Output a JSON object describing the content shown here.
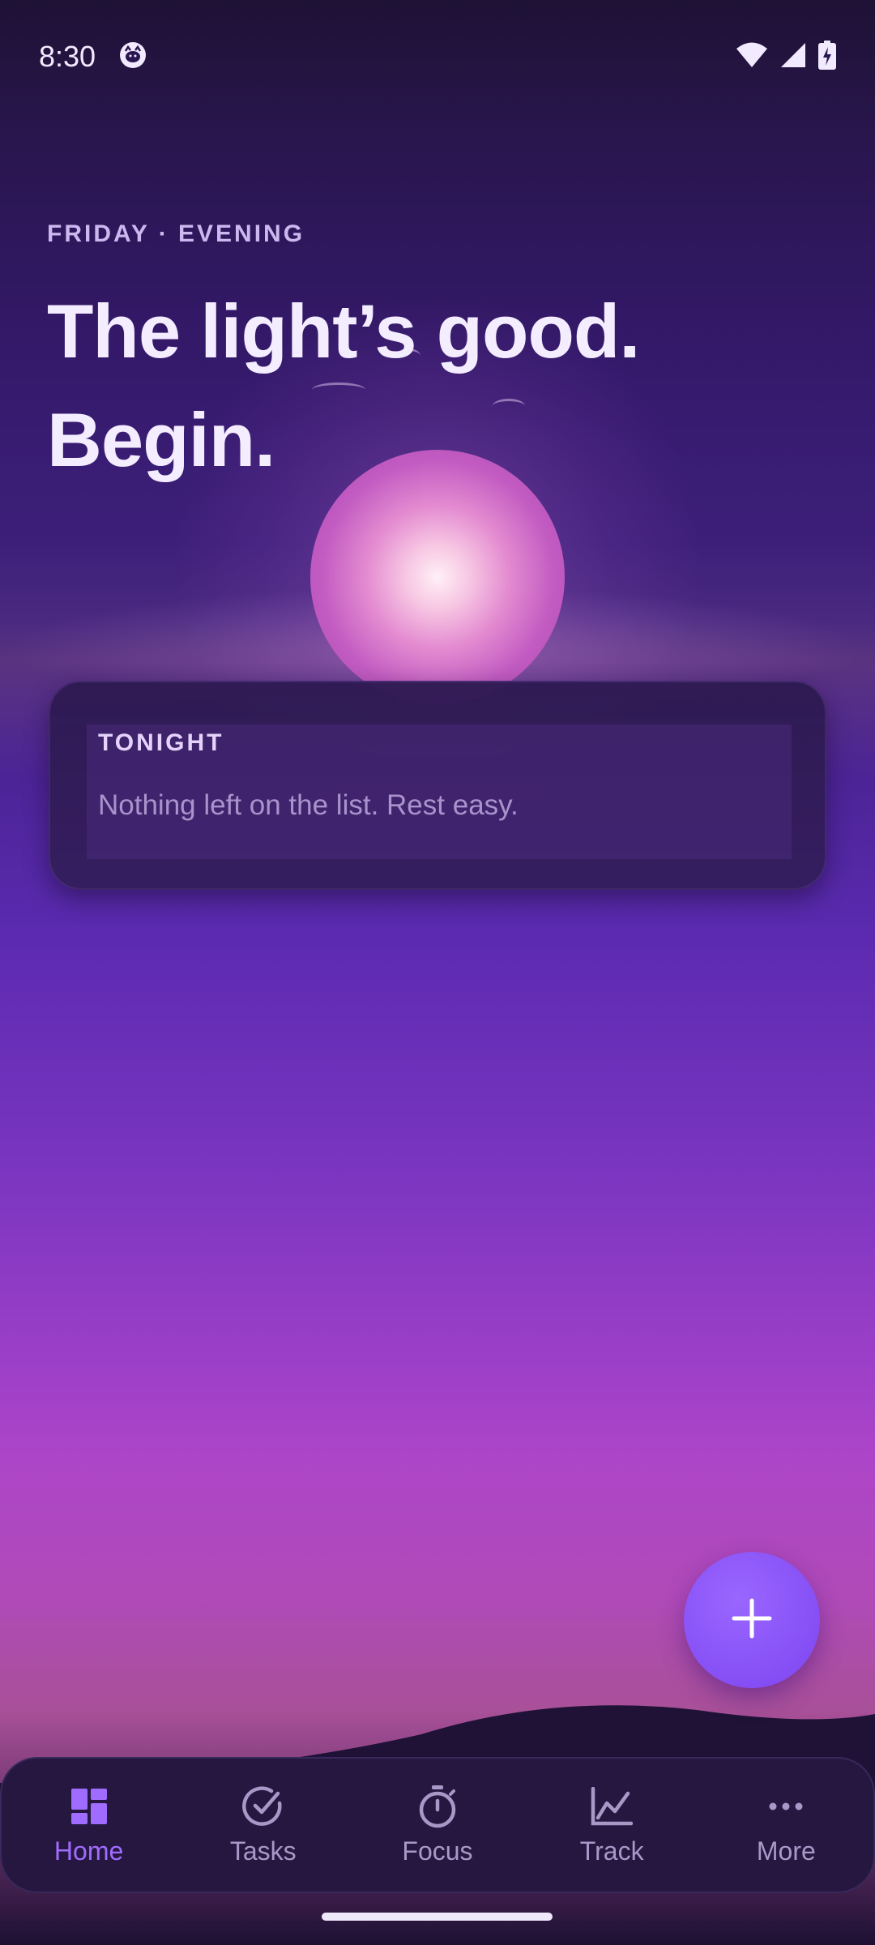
{
  "status_bar": {
    "time": "8:30",
    "notification_icon": "cat-face-icon",
    "icons": [
      "wifi-icon",
      "cell-signal-icon",
      "battery-charging-icon"
    ]
  },
  "header": {
    "daypart": "FRIDAY · EVENING",
    "headline_line1": "The light’s good.",
    "headline_line2": "Begin."
  },
  "card": {
    "title": "TONIGHT",
    "message": "Nothing left on the list. Rest easy."
  },
  "fab": {
    "icon": "plus-icon"
  },
  "nav": {
    "items": [
      {
        "label": "Home",
        "icon": "dashboard-icon",
        "active": true
      },
      {
        "label": "Tasks",
        "icon": "check-circle-icon",
        "active": false
      },
      {
        "label": "Focus",
        "icon": "stopwatch-icon",
        "active": false
      },
      {
        "label": "Track",
        "icon": "line-chart-icon",
        "active": false
      },
      {
        "label": "More",
        "icon": "more-horizontal-icon",
        "active": false
      }
    ]
  },
  "colors": {
    "accent": "#a06cff",
    "fab": "#7c45f0",
    "nav_background": "#251740",
    "inactive": "#a898c8"
  }
}
